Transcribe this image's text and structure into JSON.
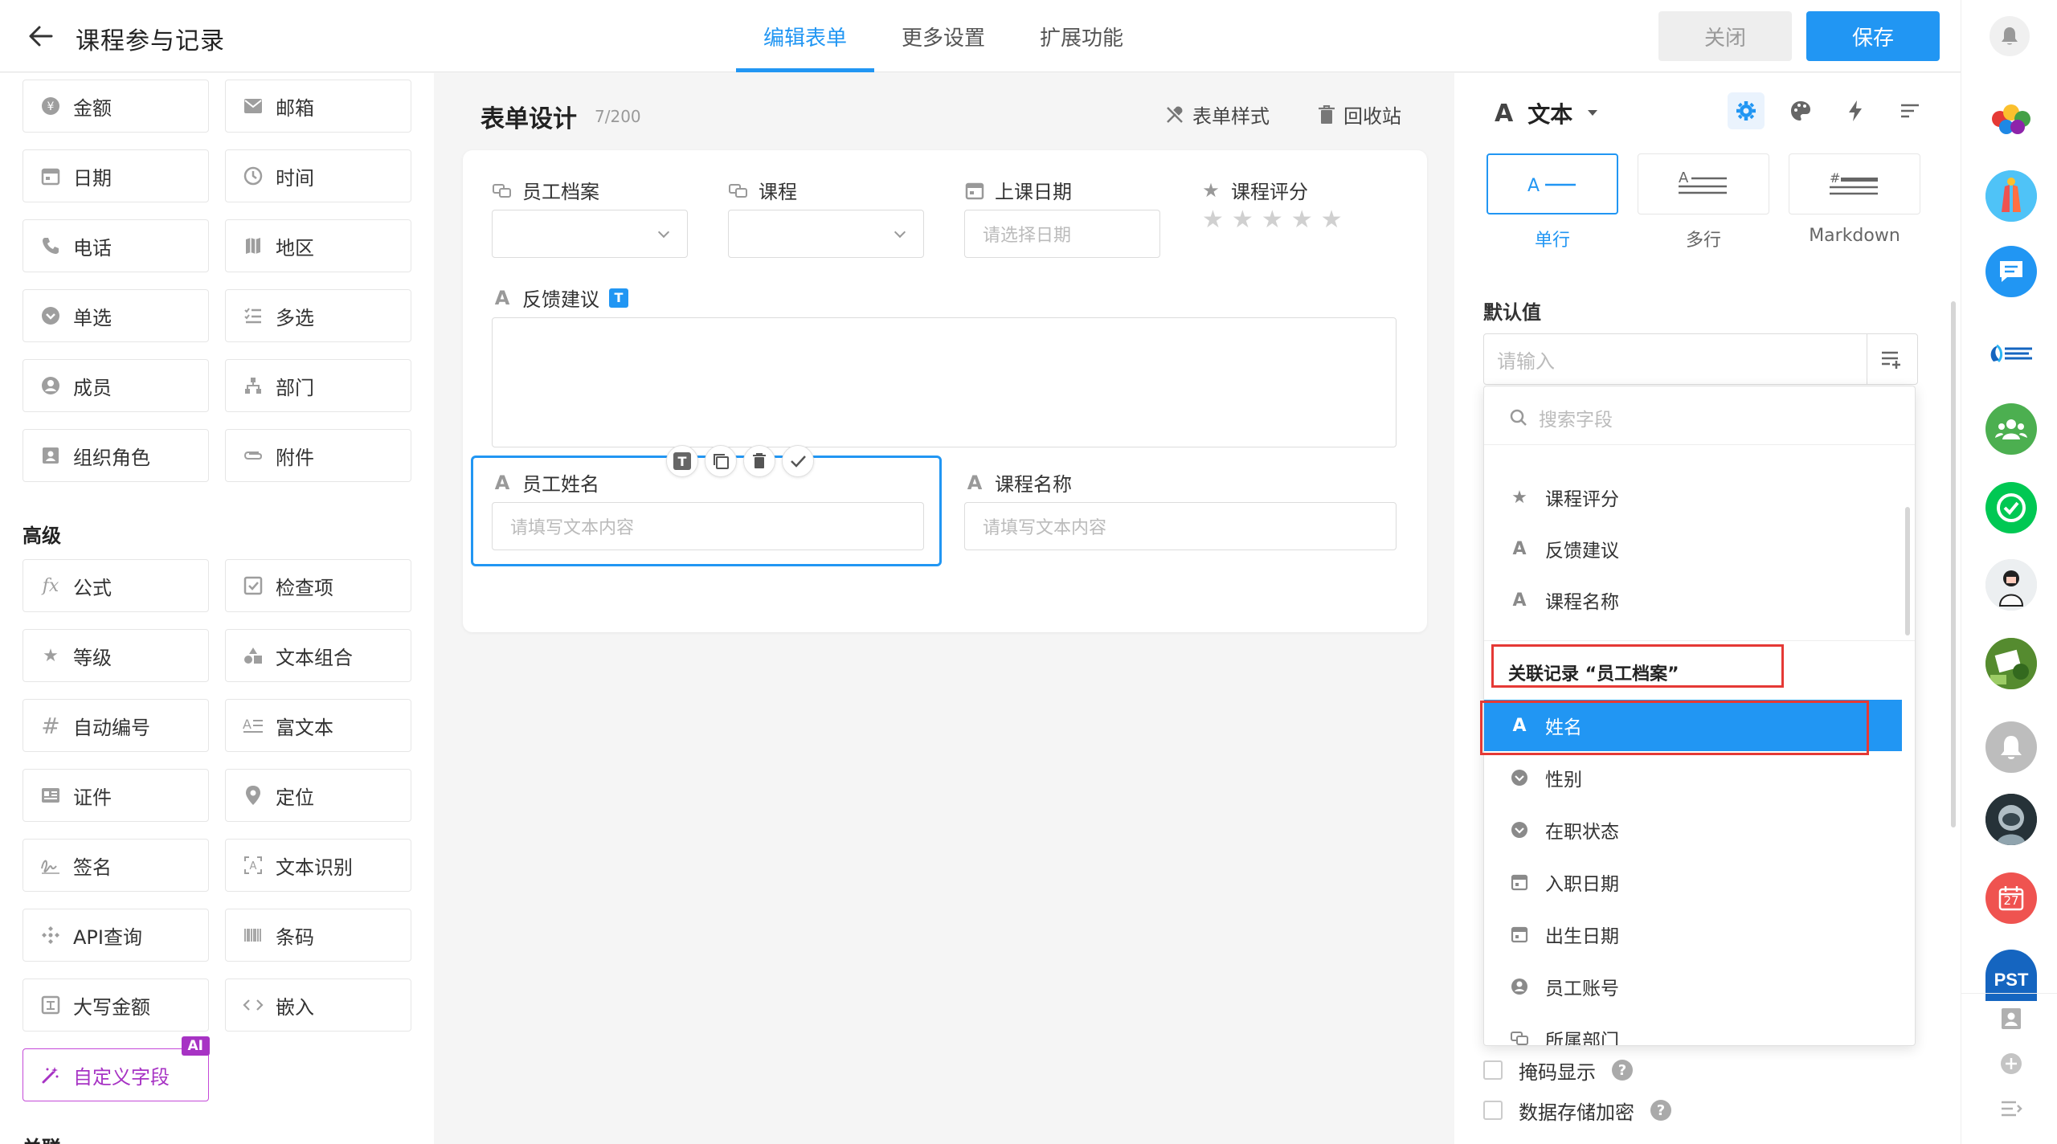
{
  "header": {
    "title": "课程参与记录",
    "tabs": [
      {
        "label": "编辑表单",
        "active": true
      },
      {
        "label": "更多设置",
        "active": false
      },
      {
        "label": "扩展功能",
        "active": false
      }
    ],
    "close_label": "关闭",
    "save_label": "保存"
  },
  "palette": {
    "basic_items": [
      "金额",
      "邮箱",
      "日期",
      "时间",
      "电话",
      "地区",
      "单选",
      "多选",
      "成员",
      "部门",
      "组织角色",
      "附件"
    ],
    "advanced_title": "高级",
    "advanced_items": [
      "公式",
      "检查项",
      "等级",
      "文本组合",
      "自动编号",
      "富文本",
      "证件",
      "定位",
      "签名",
      "文本识别",
      "API查询",
      "条码",
      "大写金额",
      "嵌入"
    ],
    "custom_field": "自定义字段",
    "ai_badge": "AI",
    "next_section_partial": "关联"
  },
  "form_design": {
    "title": "表单设计",
    "count": "7/200",
    "style_label": "表单样式",
    "trash_label": "回收站",
    "fields": {
      "employee_file": "员工档案",
      "course": "课程",
      "class_date": "上课日期",
      "class_date_placeholder": "请选择日期",
      "course_rating": "课程评分",
      "feedback": "反馈建议",
      "feedback_badge": "T",
      "employee_name": "员工姓名",
      "employee_name_placeholder": "请填写文本内容",
      "course_name": "课程名称",
      "course_name_placeholder": "请填写文本内容",
      "toolbar_badge": "T"
    },
    "rating_stars": 5
  },
  "props": {
    "field_type": "文本",
    "style_options": [
      {
        "label": "单行",
        "active": true
      },
      {
        "label": "多行",
        "active": false
      },
      {
        "label": "Markdown",
        "active": false
      }
    ],
    "style_icon_text": "A",
    "default_value_label": "默认值",
    "default_placeholder": "请输入",
    "mask_label": "掩码显示",
    "encrypt_label": "数据存储加密",
    "help_glyph": "?"
  },
  "dropdown": {
    "search_placeholder": "搜索字段",
    "items": [
      {
        "label": "课程评分",
        "icon": "star-icon"
      },
      {
        "label": "反馈建议",
        "icon": "text-icon"
      },
      {
        "label": "课程名称",
        "icon": "text-icon"
      }
    ],
    "group_title": "关联记录 “员工档案”",
    "group_items": [
      {
        "label": "姓名",
        "icon": "text-icon",
        "highlight": true
      },
      {
        "label": "性别",
        "icon": "radio-icon"
      },
      {
        "label": "在职状态",
        "icon": "radio-icon"
      },
      {
        "label": "入职日期",
        "icon": "calendar-icon"
      },
      {
        "label": "出生日期",
        "icon": "calendar-icon"
      },
      {
        "label": "员工账号",
        "icon": "user-icon"
      },
      {
        "label": "所属部门",
        "icon": "dept-icon"
      }
    ]
  },
  "appbar": {
    "calendar_day": "27",
    "pst_label": "PST"
  },
  "colors": {
    "accent": "#2196f3",
    "highlight_box": "#e53935",
    "ai_purple": "#a733c4"
  }
}
